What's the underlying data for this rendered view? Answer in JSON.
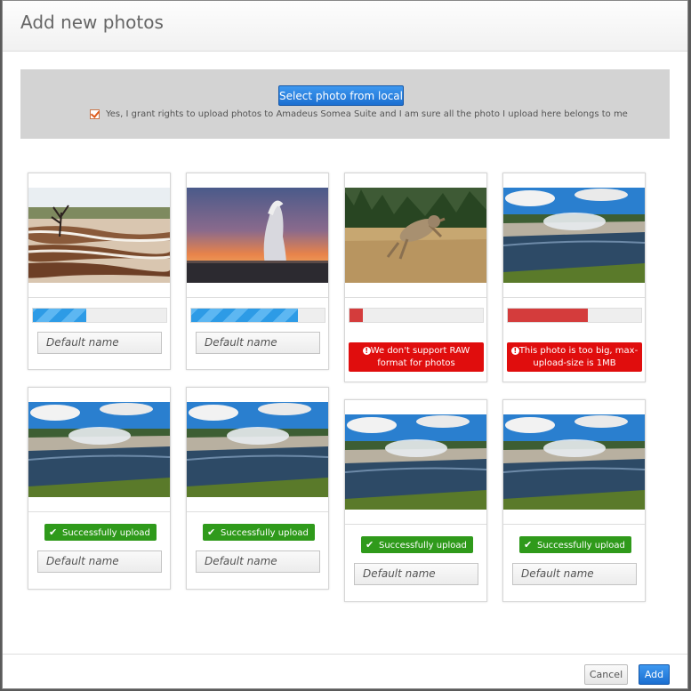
{
  "modal": {
    "title": "Add new photos"
  },
  "upload": {
    "select_label": "Select photo from local",
    "grant_text": "Yes, I grant rights to upload photos to Amadeus Somea Suite and I am sure all the photo I upload here belongs to me",
    "grant_checked": true
  },
  "cards": [
    {
      "thumb": "terraces",
      "status": "uploading",
      "progress": 0.4,
      "name_placeholder": "Default name"
    },
    {
      "thumb": "geyser",
      "status": "uploading",
      "progress": 0.8,
      "name_placeholder": "Default name"
    },
    {
      "thumb": "coyote",
      "status": "error",
      "progress": 0.1,
      "error": "We don't support RAW format for photos"
    },
    {
      "thumb": "river",
      "status": "error",
      "progress": 0.6,
      "error": "This photo is too big, max-upload-size is 1MB"
    },
    {
      "thumb": "river",
      "status": "success",
      "success": "Successfully upload",
      "name_placeholder": "Default name"
    },
    {
      "thumb": "river",
      "status": "success",
      "success": "Successfully upload",
      "name_placeholder": "Default name"
    },
    {
      "thumb": "river",
      "status": "success",
      "success": "Successfully upload",
      "name_placeholder": "Default name"
    },
    {
      "thumb": "river",
      "status": "success",
      "success": "Successfully upload",
      "name_placeholder": "Default name"
    }
  ],
  "footer": {
    "cancel_label": "Cancel",
    "add_label": "Add"
  },
  "colors": {
    "primary": "#1c6fd1",
    "error": "#e00d0d",
    "success": "#2f9a1b",
    "progress": "#2d9be6"
  }
}
